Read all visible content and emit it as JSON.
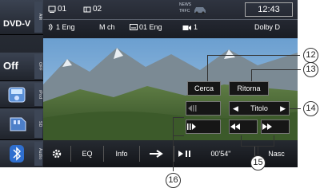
{
  "sidebar": {
    "source_label": "DVD-V",
    "off_label": "Off",
    "vlabels": [
      "AM",
      "OFF",
      "iPod",
      "SD",
      "Audio"
    ]
  },
  "status": {
    "title_number": "01",
    "chapter_number": "02",
    "news_label": "NEWS",
    "trfc_label": "TRFC",
    "clock": "12:43",
    "audio_track": "1 Eng",
    "channel": "M ch",
    "subtitle": "01 Eng",
    "angle": "1",
    "audio_format": "Dolby D"
  },
  "controls": {
    "search_label": "Cerca",
    "return_label": "Ritorna",
    "title_label": "Titolo"
  },
  "bottombar": {
    "eq_label": "EQ",
    "info_label": "Info",
    "playback_time": "00'54\"",
    "hide_label": "Nasc"
  },
  "callouts": [
    "12",
    "13",
    "14",
    "15",
    "16"
  ],
  "icons": {
    "gear": "gear-icon",
    "arrow": "arrow-right-icon",
    "play_pause": "play-pause-icon",
    "bluetooth": "bluetooth-icon"
  }
}
